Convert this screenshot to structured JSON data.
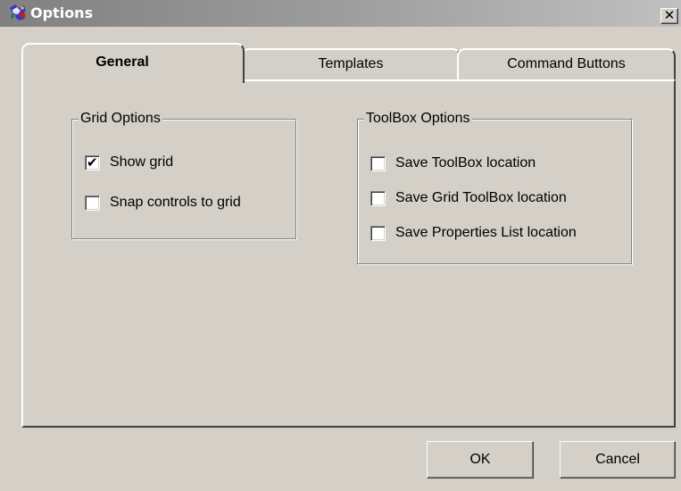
{
  "window": {
    "title": "Options",
    "close_label": "✕",
    "close_glyph": "x-icon"
  },
  "tabs": [
    {
      "label": "General",
      "active": true
    },
    {
      "label": "Templates",
      "active": false
    },
    {
      "label": "Command Buttons",
      "active": false
    }
  ],
  "grid_options": {
    "legend": "Grid Options",
    "items": [
      {
        "label": "Show grid",
        "checked": true
      },
      {
        "label": "Snap controls to grid",
        "checked": false
      }
    ]
  },
  "toolbox_options": {
    "legend": "ToolBox Options",
    "items": [
      {
        "label": "Save ToolBox location",
        "checked": false
      },
      {
        "label": "Save Grid ToolBox location",
        "checked": false
      },
      {
        "label": "Save Properties List location",
        "checked": false
      }
    ]
  },
  "buttons": {
    "ok": "OK",
    "cancel": "Cancel"
  },
  "check_mark": "✔",
  "colors": {
    "face": "#d4d0c8",
    "titlebar_start": "#808080",
    "titlebar_end": "#c0c0c0"
  }
}
